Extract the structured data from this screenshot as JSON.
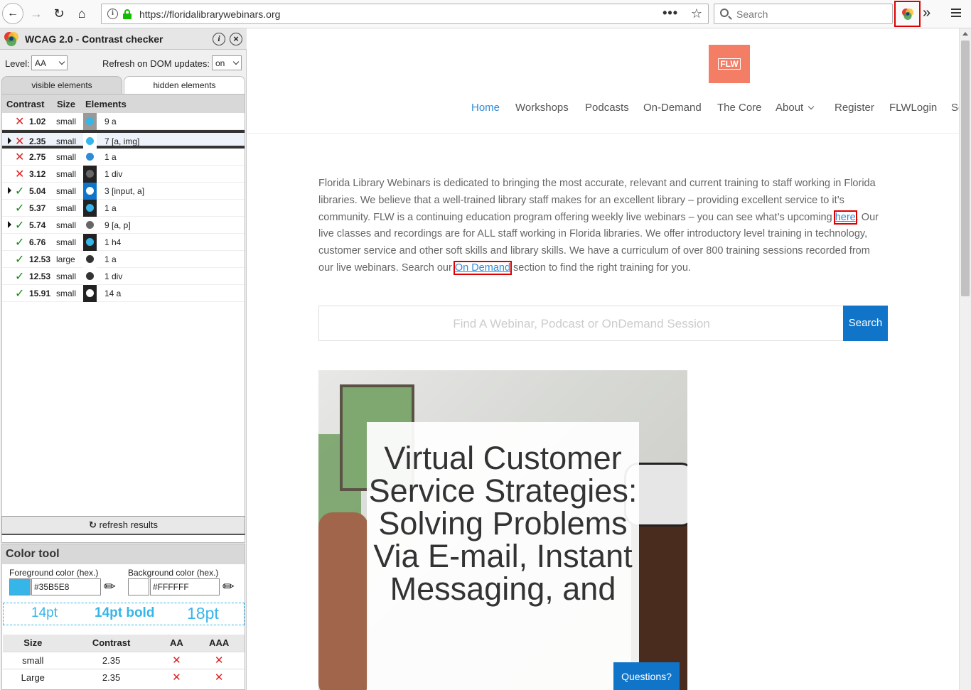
{
  "browser": {
    "url": "https://floridalibrarywebinars.org",
    "search_placeholder": "Search",
    "more_dots": "•••"
  },
  "sidebar": {
    "title": "WCAG 2.0 - Contrast checker",
    "level_label": "Level:",
    "level_value": "AA",
    "refresh_label": "Refresh on DOM updates:",
    "refresh_value": "on",
    "tabs": [
      "visible elements",
      "hidden elements"
    ],
    "columns": [
      "Contrast",
      "Size",
      "Elements"
    ],
    "rows": [
      {
        "pass": false,
        "contrast": "1.02",
        "size": "small",
        "fg": "#35B5E8",
        "bg": "#999999",
        "elements": "9 a",
        "expandable": false,
        "selected": false
      },
      {
        "pass": false,
        "contrast": "2.35",
        "size": "small",
        "fg": "#35B5E8",
        "bg": "#FFFFFF",
        "elements": "7 [a, img]",
        "expandable": true,
        "selected": true
      },
      {
        "pass": false,
        "contrast": "2.75",
        "size": "small",
        "fg": "#2E8BD8",
        "bg": "#FFFFFF",
        "elements": "1 a",
        "expandable": false,
        "selected": false
      },
      {
        "pass": false,
        "contrast": "3.12",
        "size": "small",
        "fg": "#666666",
        "bg": "#222222",
        "elements": "1 div",
        "expandable": false,
        "selected": false
      },
      {
        "pass": true,
        "contrast": "5.04",
        "size": "small",
        "fg": "#FFFFFF",
        "bg": "#1074C8",
        "elements": "3 [input, a]",
        "expandable": true,
        "selected": false
      },
      {
        "pass": true,
        "contrast": "5.37",
        "size": "small",
        "fg": "#35B5E8",
        "bg": "#222222",
        "elements": "1 a",
        "expandable": false,
        "selected": false
      },
      {
        "pass": true,
        "contrast": "5.74",
        "size": "small",
        "fg": "#666666",
        "bg": "#FFFFFF",
        "elements": "9 [a, p]",
        "expandable": true,
        "selected": false
      },
      {
        "pass": true,
        "contrast": "6.76",
        "size": "small",
        "fg": "#35B5E8",
        "bg": "#222222",
        "elements": "1 h4",
        "expandable": false,
        "selected": false
      },
      {
        "pass": true,
        "contrast": "12.53",
        "size": "large",
        "fg": "#333333",
        "bg": "#FFFFFF",
        "elements": "1 a",
        "expandable": false,
        "selected": false
      },
      {
        "pass": true,
        "contrast": "12.53",
        "size": "small",
        "fg": "#333333",
        "bg": "#FFFFFF",
        "elements": "1 div",
        "expandable": false,
        "selected": false
      },
      {
        "pass": true,
        "contrast": "15.91",
        "size": "small",
        "fg": "#FFFFFF",
        "bg": "#222222",
        "elements": "14 a",
        "expandable": false,
        "selected": false
      }
    ],
    "refresh_button": "refresh results",
    "color_tool": {
      "title": "Color tool",
      "fg_label": "Foreground color (hex.)",
      "fg_value": "#35B5E8",
      "bg_label": "Background color (hex.)",
      "bg_value": "#FFFFFF",
      "preview": [
        "14pt",
        "14pt bold",
        "18pt"
      ],
      "table_headers": [
        "Size",
        "Contrast",
        "AA",
        "AAA"
      ],
      "table_rows": [
        {
          "size": "small",
          "contrast": "2.35",
          "aa": "✕",
          "aaa": "✕"
        },
        {
          "size": "Large",
          "contrast": "2.35",
          "aa": "✕",
          "aaa": "✕"
        }
      ]
    }
  },
  "site": {
    "logo": "FLW",
    "nav": [
      "Home",
      "Workshops",
      "Podcasts",
      "On-Demand",
      "The Core",
      "About",
      "Register",
      "FLWLogin",
      "Se"
    ],
    "intro": {
      "before_here": "Florida Library Webinars is dedicated to bringing the most accurate, relevant and current training to staff working in Florida libraries. We believe that a well-trained library staff makes for an excellent library – providing excellent service to it’s community.  FLW is a continuing education program offering weekly live webinars – you can see what’s upcoming ",
      "here": "here",
      "middle": ".  Our live classes and recordings are for ALL staff working in Florida libraries. We offer introductory level training in technology, customer service and other soft skills and library skills.  We have a curriculum of over 800 training sessions recorded from our live webinars.  Search our ",
      "on_demand": "On Demand",
      "after": " section to find the right training for you."
    },
    "search_placeholder": "Find A Webinar, Podcast or OnDemand Session",
    "search_button": "Search",
    "hero_title": "Virtual Customer Service Strategies: Solving Problems Via E-mail, Instant Messaging, and",
    "questions_button": "Questions?"
  }
}
